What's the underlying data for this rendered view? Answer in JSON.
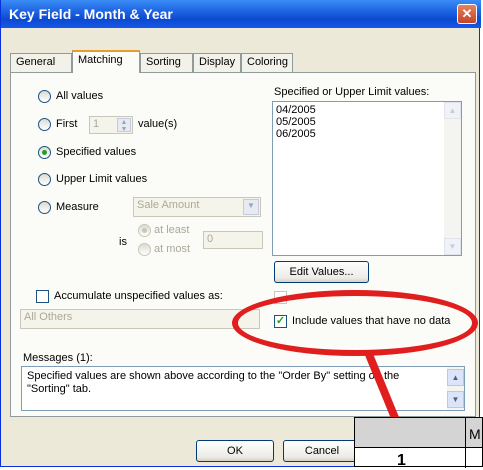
{
  "window": {
    "title": "Key Field - Month & Year",
    "close_glyph": "✕"
  },
  "tabs": [
    {
      "label": "General"
    },
    {
      "label": "Matching"
    },
    {
      "label": "Sorting"
    },
    {
      "label": "Display"
    },
    {
      "label": "Coloring"
    }
  ],
  "matching": {
    "all_values": "All values",
    "first": "First",
    "first_value": "1",
    "first_suffix": "value(s)",
    "specified": "Specified values",
    "upper_limit": "Upper Limit values",
    "measure": "Measure",
    "measure_select": "Sale Amount",
    "is_label": "is",
    "at_least": "at least",
    "at_most": "at most",
    "limit_value": "0",
    "accumulate_label": "Accumulate unspecified values as:",
    "accumulate_value": "All Others"
  },
  "values_list": {
    "label": "Specified or Upper Limit values:",
    "items": [
      "04/2005",
      "05/2005",
      "06/2005"
    ],
    "edit_button": "Edit Values...",
    "include_no_data": "Include values that have no data"
  },
  "messages": {
    "label": "Messages (1):",
    "text": "Specified values are shown above according to the \"Order By\" setting on the \"Sorting\" tab."
  },
  "buttons": {
    "ok": "OK",
    "cancel": "Cancel"
  },
  "overlay": {
    "header_fragment": "M",
    "cell_fragment": "1"
  },
  "colors": {
    "callout": "#e01e1e",
    "title_bar": "#1b5fe0"
  }
}
